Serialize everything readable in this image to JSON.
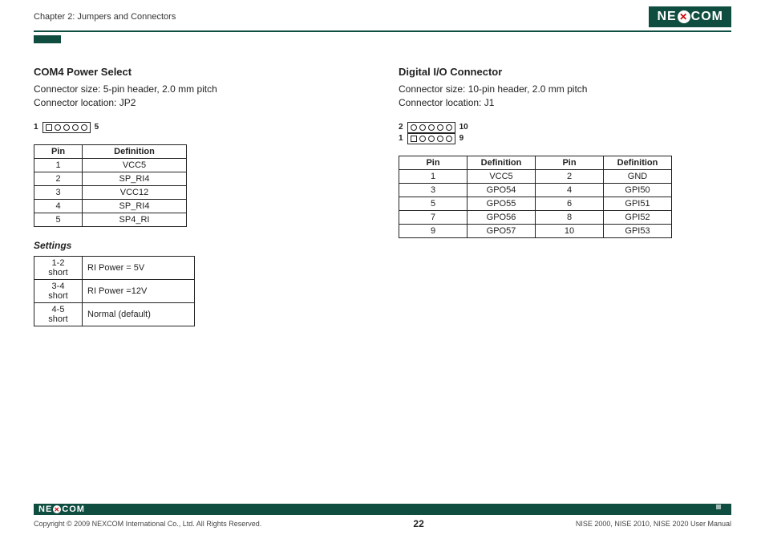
{
  "header": {
    "chapter": "Chapter 2: Jumpers and Connectors",
    "logo_pre": "NE",
    "logo_x": "✕",
    "logo_post": "COM"
  },
  "left": {
    "title": "COM4 Power Select",
    "size": "Connector size:  5-pin header, 2.0 mm pitch",
    "loc": "Connector location: JP2",
    "pin_left": "1",
    "pin_right": "5",
    "th_pin": "Pin",
    "th_def": "Definition",
    "rows": [
      {
        "p": "1",
        "d": "VCC5"
      },
      {
        "p": "2",
        "d": "SP_RI4"
      },
      {
        "p": "3",
        "d": "VCC12"
      },
      {
        "p": "4",
        "d": "SP_RI4"
      },
      {
        "p": "5",
        "d": "SP4_RI"
      }
    ],
    "settings_h": "Settings",
    "settings": [
      {
        "k": "1-2 short",
        "v": "RI Power = 5V"
      },
      {
        "k": "3-4 short",
        "v": "RI Power =12V"
      },
      {
        "k": "4-5 short",
        "v": "Normal (default)"
      }
    ]
  },
  "right": {
    "title": "Digital I/O Connector",
    "size": "Connector size:  10-pin header, 2.0 mm pitch",
    "loc": "Connector location: J1",
    "top_l": "2",
    "top_r": "10",
    "bot_l": "1",
    "bot_r": "9",
    "th_pin": "Pin",
    "th_def": "Definition",
    "rows": [
      {
        "p1": "1",
        "d1": "VCC5",
        "p2": "2",
        "d2": "GND"
      },
      {
        "p1": "3",
        "d1": "GPO54",
        "p2": "4",
        "d2": "GPI50"
      },
      {
        "p1": "5",
        "d1": "GPO55",
        "p2": "6",
        "d2": "GPI51"
      },
      {
        "p1": "7",
        "d1": "GPO56",
        "p2": "8",
        "d2": "GPI52"
      },
      {
        "p1": "9",
        "d1": "GPO57",
        "p2": "10",
        "d2": "GPI53"
      }
    ]
  },
  "footer": {
    "copyright": "Copyright © 2009 NEXCOM International Co., Ltd. All Rights Reserved.",
    "page": "22",
    "manual": "NISE 2000, NISE 2010, NISE 2020 User Manual"
  }
}
